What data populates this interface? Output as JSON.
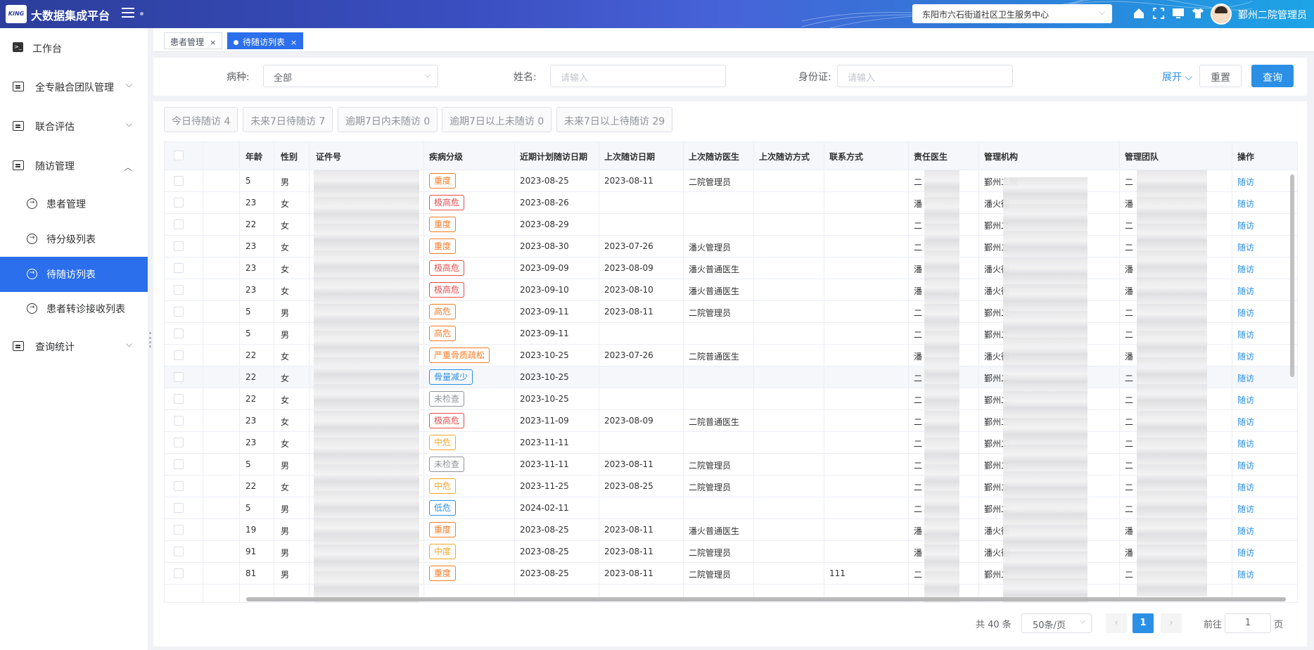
{
  "app": {
    "logo_text": "KING",
    "title": "大数据集成平台"
  },
  "header": {
    "org_select": "东阳市六石街道社区卫生服务中心",
    "user_name": "鄞州二院管理员"
  },
  "sidebar": {
    "items": [
      {
        "label": "工作台"
      },
      {
        "label": "全专融合团队管理"
      },
      {
        "label": "联合评估"
      },
      {
        "label": "随访管理"
      },
      {
        "label": "患者管理"
      },
      {
        "label": "待分级列表"
      },
      {
        "label": "待随访列表"
      },
      {
        "label": "患者转诊接收列表"
      },
      {
        "label": "查询统计"
      }
    ]
  },
  "tabs": [
    {
      "label": "患者管理",
      "close": "×"
    },
    {
      "label": "待随访列表",
      "close": "×"
    }
  ],
  "filter": {
    "disease_label": "病种:",
    "disease_value": "全部",
    "name_label": "姓名:",
    "name_placeholder": "请输入",
    "id_label": "身份证:",
    "id_placeholder": "请输入",
    "expand": "展开",
    "reset": "重置",
    "query": "查询"
  },
  "quick_filters": [
    "今日待随访 4",
    "未来7日待随访 7",
    "逾期7日内未随访 0",
    "逾期7日以上未随访 0",
    "未来7日以上待随访 29"
  ],
  "table": {
    "headers": [
      "年龄",
      "性别",
      "证件号",
      "疾病分级",
      "近期计划随访日期",
      "上次随访日期",
      "上次随访医生",
      "上次随访方式",
      "联系方式",
      "责任医生",
      "管理机构",
      "管理团队",
      "操作"
    ],
    "action_label": "随访",
    "rows": [
      {
        "age": "5",
        "sex": "男",
        "level": "重度",
        "color": "#f57c26",
        "plan": "2023-08-25",
        "last": "2023-08-11",
        "doctor": "二院管理员",
        "contact": "",
        "resp": "二",
        "org": "鄞州二院",
        "team": "二"
      },
      {
        "age": "23",
        "sex": "女",
        "level": "极高危",
        "color": "#e94b4b",
        "plan": "2023-08-26",
        "last": "",
        "doctor": "",
        "contact": "",
        "resp": "潘",
        "org": "潘火街",
        "team": "潘"
      },
      {
        "age": "22",
        "sex": "女",
        "level": "重度",
        "color": "#f57c26",
        "plan": "2023-08-29",
        "last": "",
        "doctor": "",
        "contact": "",
        "resp": "二",
        "org": "鄞州二",
        "team": "二"
      },
      {
        "age": "23",
        "sex": "女",
        "level": "重度",
        "color": "#f57c26",
        "plan": "2023-08-30",
        "last": "2023-07-26",
        "doctor": "潘火管理员",
        "contact": "",
        "resp": "二",
        "org": "鄞州二",
        "team": "二"
      },
      {
        "age": "23",
        "sex": "女",
        "level": "极高危",
        "color": "#e94b4b",
        "plan": "2023-09-09",
        "last": "2023-08-09",
        "doctor": "潘火普通医生",
        "contact": "",
        "resp": "潘",
        "org": "潘火街",
        "team": "潘"
      },
      {
        "age": "23",
        "sex": "女",
        "level": "极高危",
        "color": "#e94b4b",
        "plan": "2023-09-10",
        "last": "2023-08-10",
        "doctor": "潘火普通医生",
        "contact": "",
        "resp": "潘",
        "org": "潘火街",
        "team": "潘"
      },
      {
        "age": "5",
        "sex": "男",
        "level": "高危",
        "color": "#f57c26",
        "plan": "2023-09-11",
        "last": "2023-08-11",
        "doctor": "二院管理员",
        "contact": "",
        "resp": "二",
        "org": "鄞州二",
        "team": "二"
      },
      {
        "age": "5",
        "sex": "男",
        "level": "高危",
        "color": "#f57c26",
        "plan": "2023-09-11",
        "last": "",
        "doctor": "",
        "contact": "",
        "resp": "二",
        "org": "鄞州二",
        "team": "二"
      },
      {
        "age": "22",
        "sex": "女",
        "level": "严重骨质疏松",
        "color": "#f57c26",
        "plan": "2023-10-25",
        "last": "2023-07-26",
        "doctor": "二院普通医生",
        "contact": "",
        "resp": "潘",
        "org": "潘火街",
        "team": "潘"
      },
      {
        "age": "22",
        "sex": "女",
        "level": "骨量减少",
        "color": "#2b8fe6",
        "plan": "2023-10-25",
        "last": "",
        "doctor": "",
        "contact": "",
        "resp": "二",
        "org": "鄞州二",
        "team": "二"
      },
      {
        "age": "22",
        "sex": "女",
        "level": "未检查",
        "color": "#909399",
        "plan": "2023-10-25",
        "last": "",
        "doctor": "",
        "contact": "",
        "resp": "二",
        "org": "鄞州二",
        "team": "二"
      },
      {
        "age": "23",
        "sex": "女",
        "level": "极高危",
        "color": "#e94b4b",
        "plan": "2023-11-09",
        "last": "2023-08-09",
        "doctor": "二院普通医生",
        "contact": "",
        "resp": "二",
        "org": "鄞州二",
        "team": "二"
      },
      {
        "age": "23",
        "sex": "女",
        "level": "中危",
        "color": "#f5a623",
        "plan": "2023-11-11",
        "last": "",
        "doctor": "",
        "contact": "",
        "resp": "二",
        "org": "鄞州二",
        "team": "二"
      },
      {
        "age": "5",
        "sex": "男",
        "level": "未检查",
        "color": "#909399",
        "plan": "2023-11-11",
        "last": "2023-08-11",
        "doctor": "二院管理员",
        "contact": "",
        "resp": "二",
        "org": "鄞州二",
        "team": "二"
      },
      {
        "age": "22",
        "sex": "女",
        "level": "中危",
        "color": "#f5a623",
        "plan": "2023-11-25",
        "last": "2023-08-25",
        "doctor": "二院管理员",
        "contact": "",
        "resp": "二",
        "org": "鄞州二",
        "team": "二"
      },
      {
        "age": "5",
        "sex": "男",
        "level": "低危",
        "color": "#2b8fe6",
        "plan": "2024-02-11",
        "last": "",
        "doctor": "",
        "contact": "",
        "resp": "二",
        "org": "鄞州二",
        "team": "二"
      },
      {
        "age": "19",
        "sex": "男",
        "level": "重度",
        "color": "#f57c26",
        "plan": "2023-08-25",
        "last": "2023-08-11",
        "doctor": "潘火普通医生",
        "contact": "",
        "resp": "潘",
        "org": "潘火街",
        "team": "潘"
      },
      {
        "age": "91",
        "sex": "男",
        "level": "中度",
        "color": "#f5a623",
        "plan": "2023-08-25",
        "last": "2023-08-11",
        "doctor": "二院管理员",
        "contact": "",
        "resp": "潘",
        "org": "潘火街",
        "team": "潘"
      },
      {
        "age": "81",
        "sex": "男",
        "level": "重度",
        "color": "#f57c26",
        "plan": "2023-08-25",
        "last": "2023-08-11",
        "doctor": "二院管理员",
        "contact": "111",
        "resp": "二",
        "org": "鄞州二",
        "team": "二"
      }
    ]
  },
  "pagination": {
    "total": "共 40 条",
    "page_size": "50条/页",
    "current": "1",
    "goto_label": "前往",
    "goto_value": "1",
    "page_suffix": "页"
  }
}
